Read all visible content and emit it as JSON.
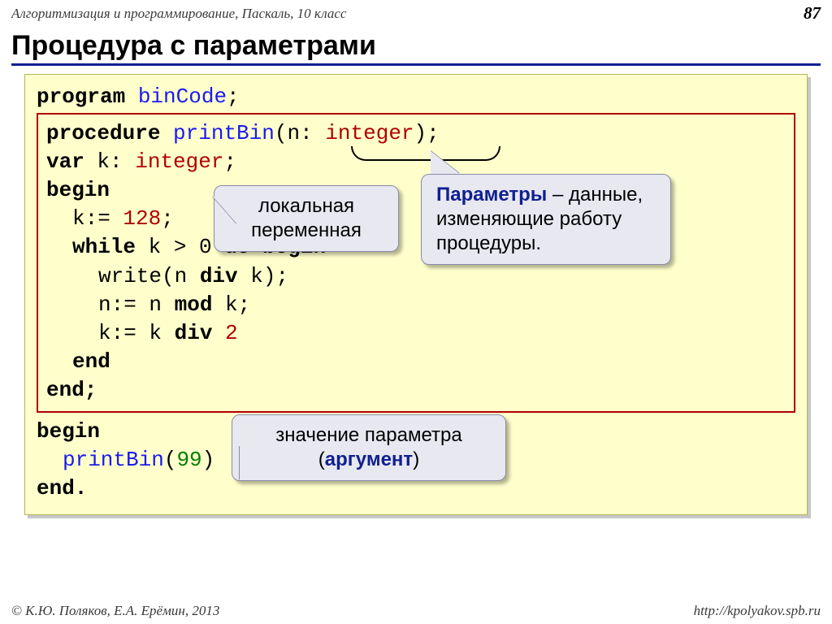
{
  "header": {
    "subject": "Алгоритмизация и программирование, Паскаль, 10 класс",
    "page": "87"
  },
  "title": "Процедура с параметрами",
  "code": {
    "l1_program": "program",
    "l1_name": "binCode",
    "l2_proc": "procedure",
    "l2_name": "printBin",
    "l2_param": "n",
    "l2_type": "integer",
    "l3_var": "var",
    "l3_k": "k",
    "l3_type": "integer",
    "l4_begin": "begin",
    "l5_assign_left": "k:=",
    "l5_num": "128",
    "l6_while": "while",
    "l6_cond": "k > 0",
    "l6_dobegin": "do begin",
    "l7_write": "write(n",
    "l7_div": "div",
    "l7_k": "k);",
    "l8": "n:= n",
    "l8_mod": "mod",
    "l8_k": "k;",
    "l9": "k:= k",
    "l9_div": "div",
    "l9_num": "2",
    "l10_end": "end",
    "l11_end": "end;",
    "m1_begin": "begin",
    "m2_call": "printBin",
    "m2_arg": "99",
    "m3_end": "end."
  },
  "callouts": {
    "local": "локальная переменная",
    "param_lead": "Параметры",
    "param_rest": " – данные, изменяющие работу процедуры.",
    "arg_lead": "значение параметра (",
    "arg_word": "аргумент",
    "arg_tail": ")"
  },
  "footer": {
    "left": "© К.Ю. Поляков, Е.А. Ерёмин, 2013",
    "right": "http://kpolyakov.spb.ru"
  }
}
